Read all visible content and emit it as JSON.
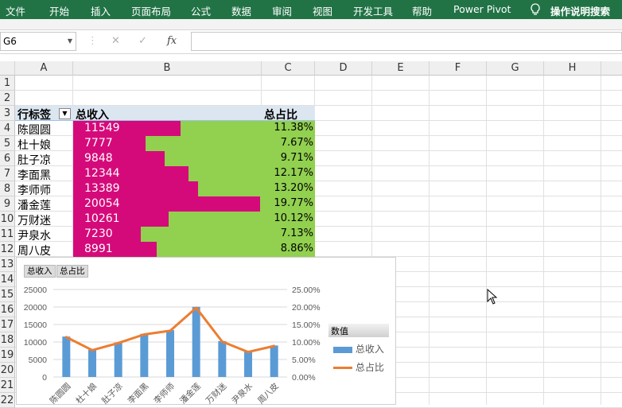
{
  "ribbon": {
    "tabs": [
      "文件",
      "开始",
      "插入",
      "页面布局",
      "公式",
      "数据",
      "审阅",
      "视图",
      "开发工具",
      "帮助",
      "Power Pivot"
    ],
    "tell_me": "操作说明搜索",
    "color": "#217346"
  },
  "formula_bar": {
    "name_box": "G6",
    "cancel": "✕",
    "enter": "✓",
    "fx": "fx",
    "content": ""
  },
  "columns": [
    "A",
    "B",
    "C",
    "D",
    "E",
    "F",
    "G",
    "H"
  ],
  "rows": [
    "1",
    "2",
    "3",
    "4",
    "5",
    "6",
    "7",
    "8",
    "9",
    "10",
    "11",
    "12",
    "13",
    "14",
    "15",
    "16",
    "17",
    "18",
    "19",
    "20",
    "21",
    "22"
  ],
  "pivot": {
    "header": {
      "row_label": "行标签",
      "sum_label": "总收入",
      "ratio_label": "总占比"
    },
    "rows": [
      {
        "name": "陈圆圆",
        "income": "11549",
        "ratio": "11.38%"
      },
      {
        "name": "杜十娘",
        "income": "7777",
        "ratio": "7.67%"
      },
      {
        "name": "肚子凉",
        "income": "9848",
        "ratio": "9.71%"
      },
      {
        "name": "李面黑",
        "income": "12344",
        "ratio": "12.17%"
      },
      {
        "name": "李师师",
        "income": "13389",
        "ratio": "13.20%"
      },
      {
        "name": "潘金莲",
        "income": "20054",
        "ratio": "19.77%"
      },
      {
        "name": "万财迷",
        "income": "10261",
        "ratio": "10.12%"
      },
      {
        "name": "尹泉水",
        "income": "7230",
        "ratio": "7.13%"
      },
      {
        "name": "周八皮",
        "income": "8991",
        "ratio": "8.86%"
      }
    ],
    "colors": {
      "bar": "#d50a7a",
      "bar_bg": "#92d050",
      "header": "#dce6f1"
    }
  },
  "chart_data": {
    "type": "bar",
    "field_buttons": [
      "总收入",
      "总占比"
    ],
    "categories": [
      "陈圆圆",
      "杜十娘",
      "肚子凉",
      "李面黑",
      "李师师",
      "潘金莲",
      "万财迷",
      "尹泉水",
      "周八皮"
    ],
    "series": [
      {
        "name": "总收入",
        "type": "bar",
        "axis": "left",
        "values": [
          11549,
          7777,
          9848,
          12344,
          13389,
          20054,
          10261,
          7230,
          8991
        ],
        "color": "#5b9bd5"
      },
      {
        "name": "总占比",
        "type": "line",
        "axis": "right",
        "values": [
          0.1138,
          0.0767,
          0.0971,
          0.1217,
          0.132,
          0.1977,
          0.1012,
          0.0713,
          0.0886
        ],
        "color": "#ed7d31"
      }
    ],
    "ylim_left": [
      0,
      25000
    ],
    "yticks_left": [
      "25000",
      "20000",
      "15000",
      "10000",
      "5000",
      "0"
    ],
    "ylim_right": [
      0,
      0.25
    ],
    "yticks_right": [
      "25.00%",
      "20.00%",
      "15.00%",
      "10.00%",
      "5.00%",
      "0.00%"
    ],
    "legend_title": "数值",
    "legend_placement": "right",
    "grid": true
  }
}
